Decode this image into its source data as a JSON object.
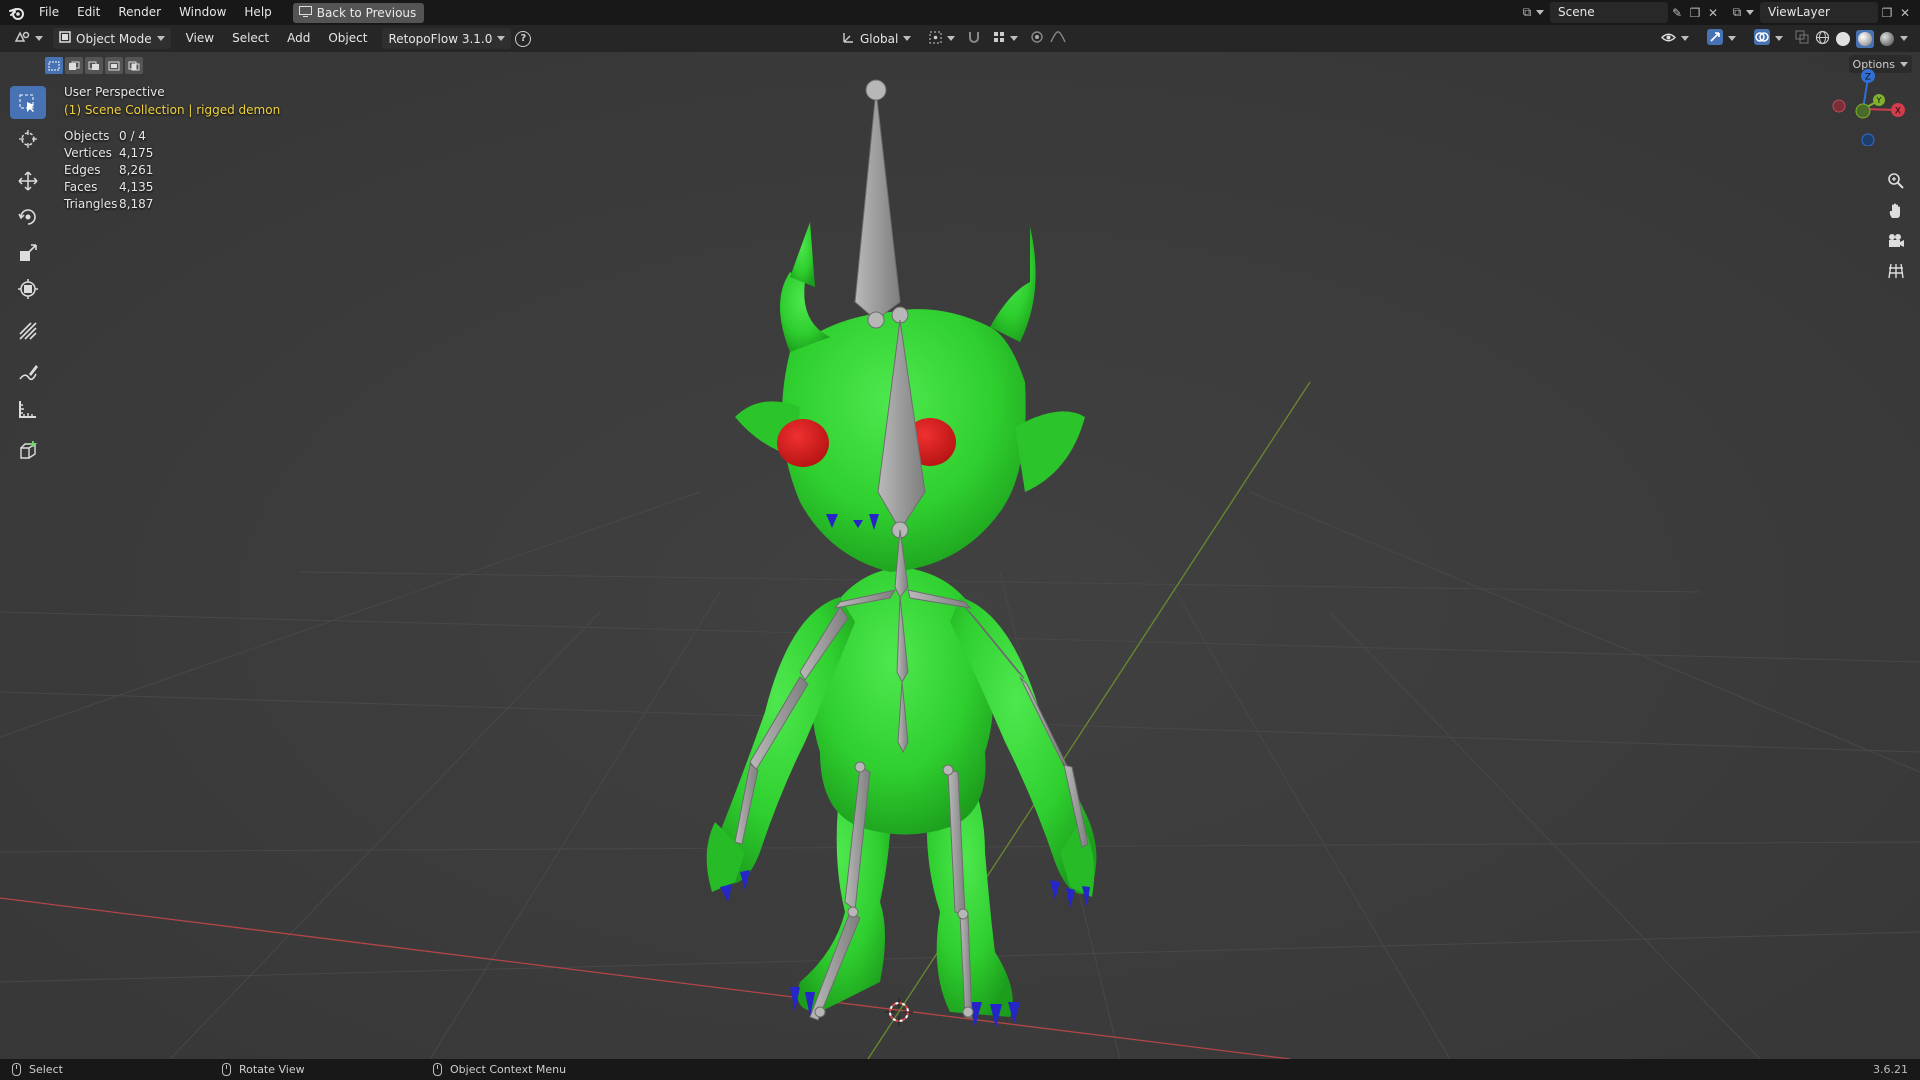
{
  "topbar": {
    "menus": [
      "File",
      "Edit",
      "Render",
      "Window",
      "Help"
    ],
    "back_button": "Back to Previous",
    "scene_name": "Scene",
    "view_layer_name": "ViewLayer"
  },
  "viewbar": {
    "mode": "Object Mode",
    "menus": [
      "View",
      "Select",
      "Add",
      "Object"
    ],
    "addon": "RetopoFlow 3.1.0",
    "help": "?",
    "orientation": "Global",
    "options_label": "Options"
  },
  "overlay": {
    "perspective": "User Perspective",
    "collection": "(1) Scene Collection | rigged demon",
    "stats": [
      {
        "label": "Objects",
        "value": "0 / 4"
      },
      {
        "label": "Vertices",
        "value": "4,175"
      },
      {
        "label": "Edges",
        "value": "8,261"
      },
      {
        "label": "Faces",
        "value": "4,135"
      },
      {
        "label": "Triangles",
        "value": "8,187"
      }
    ]
  },
  "gizmo": {
    "z": "Z",
    "y": "Y",
    "x": "X"
  },
  "toolbar": {
    "tools": [
      "select-box-icon",
      "cursor-icon",
      "move-icon",
      "rotate-icon",
      "scale-icon",
      "transform-icon",
      "annotate-line-icon",
      "annotate-icon",
      "measure-icon",
      "add-cube-icon"
    ]
  },
  "statusbar": {
    "left": "Select",
    "middle": "Rotate View",
    "right": "Object Context Menu",
    "version": "3.6.21"
  },
  "colors": {
    "accent": "#4772b3",
    "mesh": "#2fcf2f",
    "eyes": "#d21c1c",
    "claws": "#2525c8",
    "bones": "#9a9a9a",
    "collection_text": "#f0d33c"
  }
}
